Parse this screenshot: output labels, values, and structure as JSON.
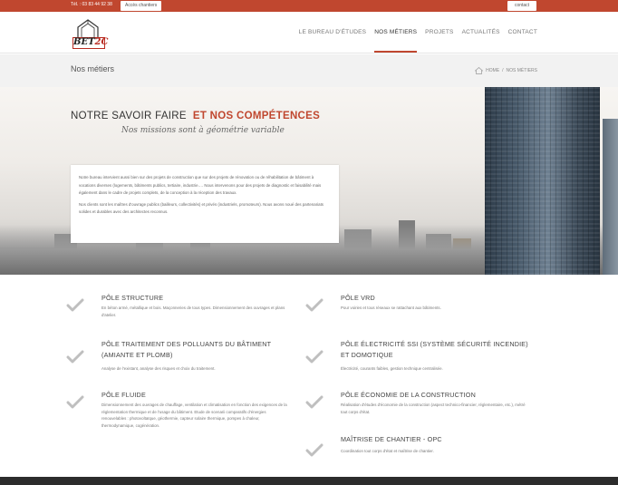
{
  "topbar": {
    "phone": "Tél. : 03 83 44 92 38",
    "chantiers_button": "Accès chantiers",
    "contact_button": "contact"
  },
  "logo": {
    "text_main": "BET",
    "text_accent": "2C"
  },
  "nav": {
    "items": [
      {
        "label": "LE BUREAU D'ÉTUDES",
        "active": false
      },
      {
        "label": "NOS MÉTIERS",
        "active": true
      },
      {
        "label": "PROJETS",
        "active": false
      },
      {
        "label": "ACTUALITÉS",
        "active": false
      },
      {
        "label": "CONTACT",
        "active": false
      }
    ]
  },
  "page_title": "Nos métiers",
  "breadcrumb": {
    "home": "HOME",
    "separator": "/",
    "current": "NOS MÉTIERS"
  },
  "hero": {
    "headline_plain": "NOTRE SAVOIR FAIRE",
    "headline_accent": "ET NOS COMPÉTENCES",
    "subline": "Nos missions sont à géométrie variable",
    "paragraph1": "Notre bureau intervient aussi bien sur des projets de construction que sur des projets de rénovation ou de réhabilitation de bâtiment à vocations diverses (logements, bâtiments publics, tertiaire, industrie…. Nous intervenons pour des projets de diagnostic et faisabilité mais également dans le cadre de projets complets, de la conception à la réception des travaux.",
    "paragraph2": "Nos clients sont les maîtres d'ouvrage publics (bailleurs, collectivités) et privés (industriels, promoteurs). Nous avons noué des partenariats solides et durables avec des architectes reconnus."
  },
  "services": {
    "left": [
      {
        "title": "PÔLE STRUCTURE",
        "desc": "En béton armé, métallique et bois. Maçonneries de tous types. Dimensionnement des ouvrages et plans d'atelier."
      },
      {
        "title": "PÔLE TRAITEMENT DES POLLUANTS DU BÂTIMENT (AMIANTE ET PLOMB)",
        "desc": "Analyse de l'existant, analyse des risques et choix du traitement."
      },
      {
        "title": "PÔLE FLUIDE",
        "desc": "Dimensionnement des ouvrages de chauffage, ventilation et climatisation en fonction des exigences de la réglementation thermique et de l'usage du bâtiment. Etude de scenarii comparatifs d'énergies renouvelables : photovoltaïque, géothermie, capteur solaire thermique, pompes à chaleur, thermodynamique, cogénération."
      }
    ],
    "right": [
      {
        "title": "PÔLE VRD",
        "desc": "Pour voiries et tous réseaux se rattachant aux bâtiments."
      },
      {
        "title": "PÔLE ÉLECTRICITÉ SSI (SYSTÈME SÉCURITÉ INCENDIE) ET DOMOTIQUE",
        "desc": "Électricité, courants faibles, gestion technique centralisée."
      },
      {
        "title": "PÔLE ÉCONOMIE DE LA CONSTRUCTION",
        "desc": "Réalisation d'études d'économie de la construction (aspect technico-financier, réglementaire, etc.), métré tout corps d'état."
      },
      {
        "title": "MAÎTRISE DE CHANTIER - OPC",
        "desc": "Coordination tout corps d'état et maîtrise de chantier."
      }
    ]
  },
  "colors": {
    "accent": "#c0472f",
    "footer": "#2c2c2c",
    "title_band": "#f2f2f2",
    "check": "#bfbfbf"
  }
}
